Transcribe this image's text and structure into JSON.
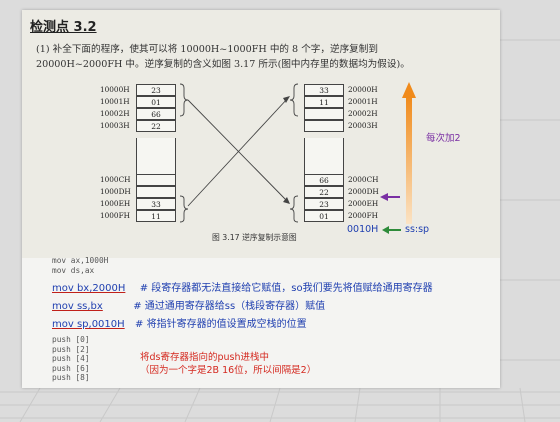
{
  "title": "检测点 3.2",
  "question": {
    "line1": "(1)  补全下面的程序，使其可以将 10000H~1000FH 中的 8 个字，逆序复制到",
    "line2": "20000H~2000FH 中。逆序复制的含义如图 3.17 所示(图中内存里的数据均为假设)。"
  },
  "left_memory": [
    {
      "addr": "10000H",
      "value": "23"
    },
    {
      "addr": "10001H",
      "value": "01"
    },
    {
      "addr": "10002H",
      "value": "66"
    },
    {
      "addr": "10003H",
      "value": "22"
    },
    {
      "addr": "",
      "value": ""
    },
    {
      "addr": "",
      "value": ""
    },
    {
      "addr": "1000CH",
      "value": ""
    },
    {
      "addr": "1000DH",
      "value": ""
    },
    {
      "addr": "1000EH",
      "value": "33"
    },
    {
      "addr": "1000FH",
      "value": "11"
    }
  ],
  "right_memory": [
    {
      "addr": "20000H",
      "value": "33"
    },
    {
      "addr": "20001H",
      "value": "11"
    },
    {
      "addr": "20002H",
      "value": ""
    },
    {
      "addr": "20003H",
      "value": ""
    },
    {
      "addr": "",
      "value": ""
    },
    {
      "addr": "",
      "value": ""
    },
    {
      "addr": "2000CH",
      "value": "66"
    },
    {
      "addr": "2000DH",
      "value": "22"
    },
    {
      "addr": "2000EH",
      "value": "23"
    },
    {
      "addr": "2000FH",
      "value": "01"
    }
  ],
  "figure_caption": "图 3.17   逆序复制示意图",
  "annotations": {
    "increment": "每次加2",
    "sp_offset": "0010H",
    "ss_sp": "ss:sp"
  },
  "code_top": [
    "mov ax,1000H",
    "mov ds,ax"
  ],
  "highlighted": [
    {
      "instr": "mov bx,2000H",
      "comment": "# 段寄存器都无法直接给它赋值，so我们要先将值赋给通用寄存器"
    },
    {
      "instr": "mov ss,bx",
      "comment": "# 通过通用寄存器给ss（栈段寄存器）赋值"
    },
    {
      "instr": "mov sp,0010H",
      "comment": "# 将指针寄存器的值设置成空栈的位置"
    }
  ],
  "code_push": [
    "push [0]",
    "push [2]",
    "push [4]",
    "push [6]",
    "push [8]"
  ],
  "push_note": {
    "line1": "将ds寄存器指向的push进栈中",
    "line2": "（因为一个字是2B 16位，所以间隔是2）"
  },
  "colors": {
    "annotation_purple": "#7a2fa3",
    "annotation_blue": "#1f3fb0",
    "annotation_red": "#d4281f",
    "arrow_orange": "#f39a2a",
    "arrow_green": "#2e8b3a"
  }
}
